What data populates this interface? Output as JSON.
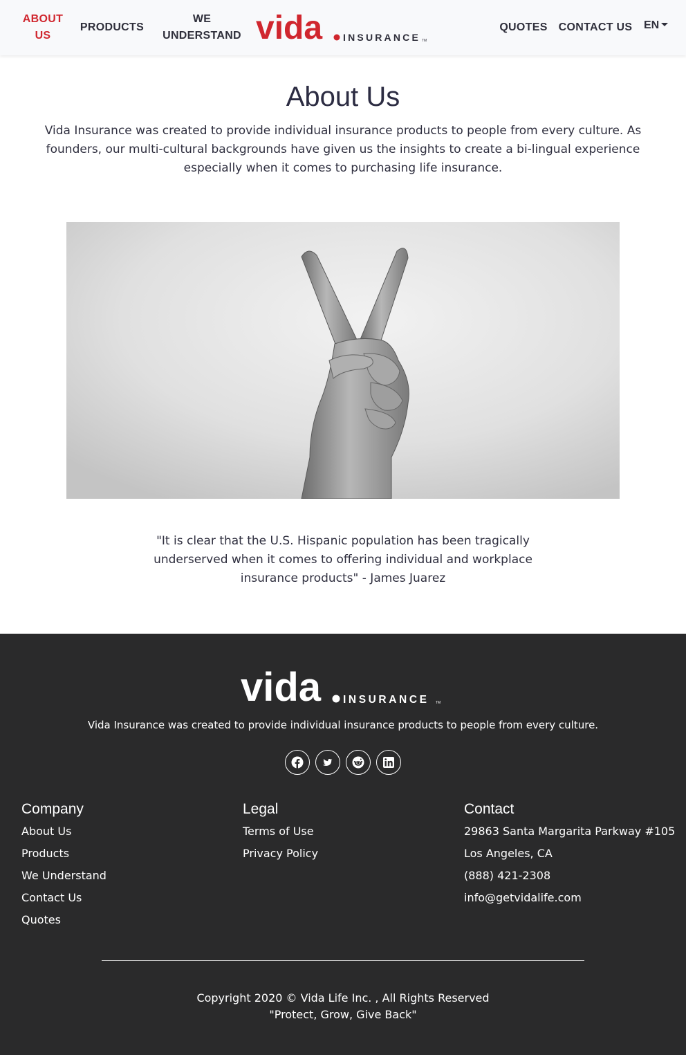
{
  "nav": {
    "left_items": [
      {
        "label_line1": "ABOUT",
        "label_line2": "US",
        "active": true
      },
      {
        "label_line1": "PRODUCTS",
        "label_line2": ""
      },
      {
        "label_line1": "WE",
        "label_line2": "UNDERSTAND"
      }
    ],
    "right_items": [
      "QUOTES",
      "CONTACT US"
    ],
    "lang": "EN",
    "logo": {
      "word": "vida",
      "suffix": "INSURANCE",
      "tm": "TM"
    }
  },
  "main": {
    "title": "About Us",
    "intro": "Vida Insurance was created to provide individual insurance products to people from every culture. As founders, our multi-cultural backgrounds have given us the insights to create a bi-lingual experience especially when it comes to purchasing life insurance.",
    "quote": "\"It is clear that the U.S. Hispanic population has been tragically underserved when it comes to offering individual and workplace insurance products\" - James Juarez"
  },
  "footer": {
    "tagline": "Vida Insurance was created to provide individual insurance products to people from every culture.",
    "social": [
      "facebook-icon",
      "twitter-icon",
      "reddit-icon",
      "linkedin-icon"
    ],
    "company": {
      "heading": "Company",
      "links": [
        "About Us",
        "Products",
        "We Understand",
        "Contact Us",
        "Quotes"
      ]
    },
    "legal": {
      "heading": "Legal",
      "links": [
        "Terms of Use",
        "Privacy Policy"
      ]
    },
    "contact": {
      "heading": "Contact",
      "lines": [
        "29863 Santa Margarita Parkway #105",
        "Los Angeles, CA",
        "(888) 421-2308",
        "info@getvidalife.com"
      ]
    },
    "copyright": "Copyright 2020 © Vida Life Inc. , All Rights Reserved",
    "motto": "\"Protect, Grow, Give Back\""
  },
  "colors": {
    "brand_red": "#d0262e",
    "footer_bg": "#2a2a2b",
    "nav_bg": "#f8f9fb"
  }
}
